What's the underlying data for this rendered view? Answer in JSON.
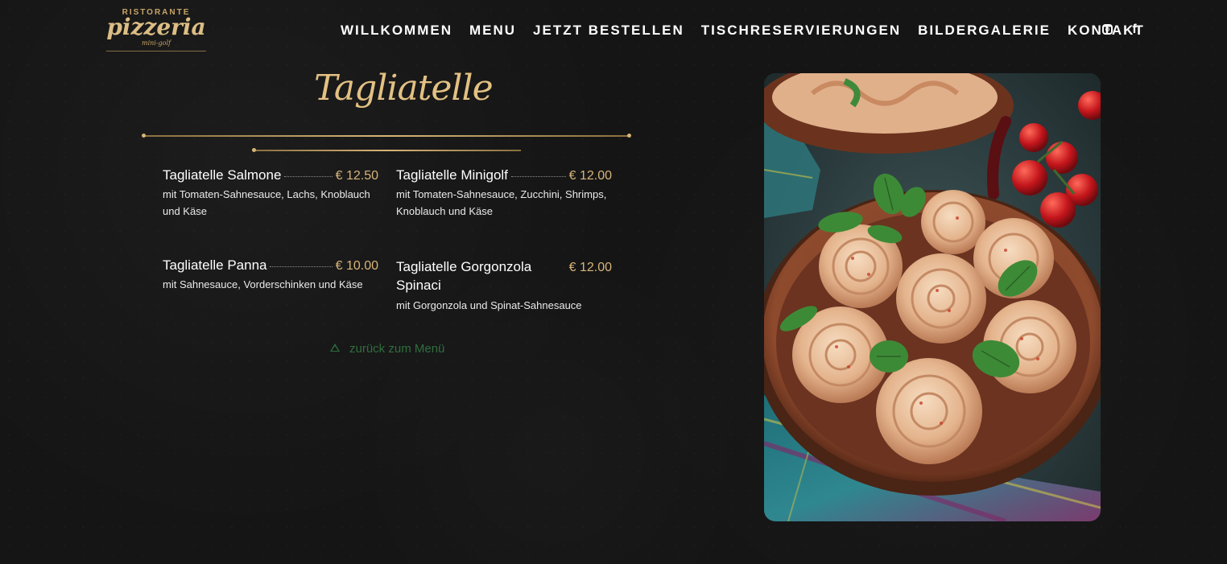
{
  "logo": {
    "top": "RISTORANTE",
    "main": "pizzeria",
    "sub": "mini-golf"
  },
  "nav": {
    "items": [
      {
        "label": "WILLKOMMEN"
      },
      {
        "label": "MENU"
      },
      {
        "label": "JETZT BESTELLEN"
      },
      {
        "label": "TISCHRESERVIERUNGEN"
      },
      {
        "label": "BILDERGALERIE"
      },
      {
        "label": "KONTAKT"
      }
    ],
    "social": {
      "instagram_icon": "instagram-icon",
      "facebook_icon": "facebook-icon",
      "facebook_glyph": "f"
    }
  },
  "main": {
    "title": "Tagliatelle",
    "items": [
      {
        "name": "Tagliatelle Salmone",
        "price": "€ 12.50",
        "description": "mit Tomaten-Sahnesauce, Lachs, Knoblauch und Käse"
      },
      {
        "name": "Tagliatelle Minigolf",
        "price": "€ 12.00",
        "description": "mit Tomaten-Sahnesauce, Zucchini, Shrimps, Knoblauch und Käse"
      },
      {
        "name": "Tagliatelle Panna",
        "price": "€ 10.00",
        "description": "mit Sahnesauce, Vorderschinken und Käse"
      },
      {
        "name": "Tagliatelle Gorgonzola Spinaci",
        "price": "€ 12.00",
        "description": "mit Gorgonzola und Spinat-Sahnesauce"
      }
    ],
    "back_link": "zurück zum Menü"
  },
  "colors": {
    "accent_gold": "#d8b57a",
    "link_green": "#2f6e3e",
    "background": "#151515"
  }
}
